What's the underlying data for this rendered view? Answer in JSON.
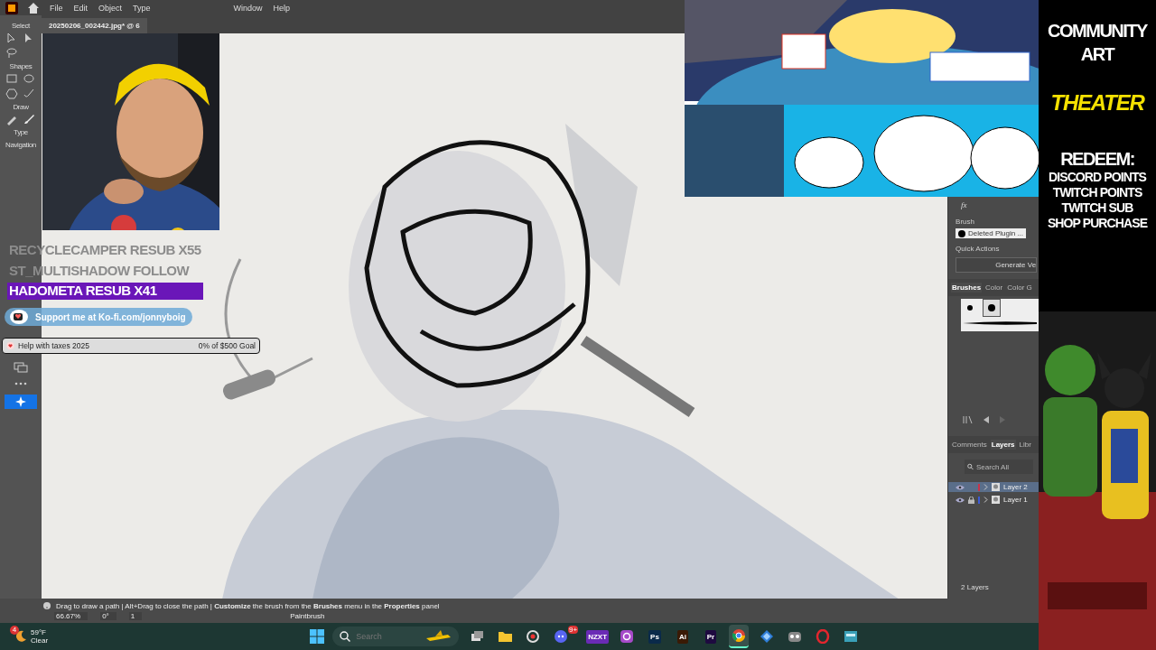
{
  "menu_bar": {
    "items": [
      "File",
      "Edit",
      "Object",
      "Type",
      "Window",
      "Help"
    ]
  },
  "document_tab": {
    "title": "20250206_002442.jpg* @ 6"
  },
  "toolbar": {
    "groups": [
      {
        "label": "Select"
      },
      {
        "label": "Shapes"
      },
      {
        "label": "Draw"
      },
      {
        "label": "Type"
      },
      {
        "label": "Navigation"
      }
    ]
  },
  "properties_panel": {
    "effects_label": "fx",
    "brush_label": "Brush",
    "brush_value": "Deleted Plugin ...",
    "quick_actions_label": "Quick Actions",
    "generate_button": "Generate Ve",
    "tabs": [
      {
        "label": "Brushes",
        "selected": true
      },
      {
        "label": "Color",
        "selected": false
      },
      {
        "label": "Color G",
        "selected": false
      }
    ]
  },
  "layers_panel": {
    "tabs": [
      {
        "label": "Comments",
        "selected": false
      },
      {
        "label": "Layers",
        "selected": true
      },
      {
        "label": "Libr",
        "selected": false
      }
    ],
    "search": {
      "placeholder": "Search All"
    },
    "layers": [
      {
        "name": "Layer 2",
        "color": "#c8334a",
        "selected": true,
        "locked": false
      },
      {
        "name": "Layer 1",
        "color": "#3d5bd6",
        "selected": false,
        "locked": true
      }
    ],
    "footer": "2 Layers"
  },
  "status_bar": {
    "hint": "Drag to draw a path  |  Alt+Drag to close the path  |  **Customize** the brush from the **Brushes** menu in the **Properties** panel",
    "zoom": "66.67%",
    "angle": "0°",
    "artboard": "1",
    "tool": "Paintbrush"
  },
  "stream_overlay": {
    "alerts": [
      {
        "text": "RECYCLECAMPER  RESUB X55",
        "kind": "faded"
      },
      {
        "text": "ST_MULTISHADOW  FOLLOW",
        "kind": "faded"
      },
      {
        "text": "HADOMETA  RESUB X41",
        "kind": "highlight"
      }
    ],
    "kofi": "Support me at Ko-fi.com/jonnyboig",
    "goal": {
      "title": "Help with taxes 2025",
      "progress": "0% of $500 Goal",
      "level": 0
    }
  },
  "sidebar": {
    "lines": [
      {
        "text": "COMMUNITY",
        "kind": "title"
      },
      {
        "text": "ART",
        "kind": "title"
      },
      {
        "text": "THEATER",
        "kind": "accent"
      },
      {
        "text": "REDEEM:",
        "kind": "title"
      },
      {
        "text": "DISCORD POINTS",
        "kind": "item"
      },
      {
        "text": "TWITCH POINTS",
        "kind": "item"
      },
      {
        "text": "TWITCH SUB",
        "kind": "item"
      },
      {
        "text": "SHOP PURCHASE",
        "kind": "item"
      }
    ]
  },
  "taskbar": {
    "weather": {
      "badge": "4",
      "temperature": "59°F",
      "condition": "Clear"
    },
    "search": {
      "placeholder": "Search"
    },
    "apps": [
      {
        "kind": "taskview",
        "selected": false
      },
      {
        "kind": "folder",
        "selected": false
      },
      {
        "kind": "capture",
        "selected": false
      },
      {
        "kind": "chat",
        "badge": "9+",
        "selected": false
      },
      {
        "kind": "label",
        "text": "NZXT",
        "color": "#6a2bb5",
        "selected": false
      },
      {
        "kind": "camera",
        "selected": false
      },
      {
        "kind": "label",
        "text": "Ps",
        "color": "#0a2a4a",
        "selected": false
      },
      {
        "kind": "label",
        "text": "Ai",
        "color": "#3a1a05",
        "selected": false
      },
      {
        "kind": "label",
        "text": "Pr",
        "color": "#1e0a40",
        "selected": false
      },
      {
        "kind": "browser",
        "selected": true
      },
      {
        "kind": "diamond",
        "selected": false
      },
      {
        "kind": "owl",
        "selected": false
      },
      {
        "kind": "ring",
        "selected": false
      },
      {
        "kind": "box",
        "selected": false
      }
    ]
  }
}
